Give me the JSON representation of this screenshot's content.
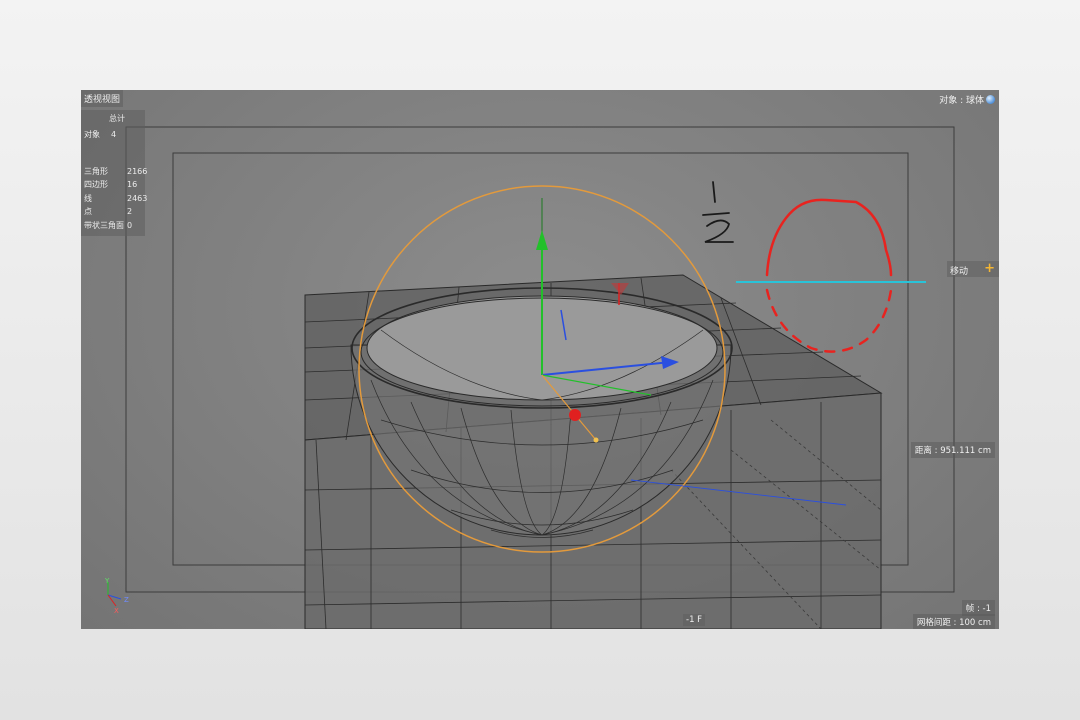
{
  "viewport": {
    "title": "透视视图",
    "object_indicator": {
      "label": "对象 : 球体",
      "icon": "sphere-icon"
    },
    "move_tool": {
      "label": "移动",
      "icon": "plus-icon",
      "accent": "#f4b633"
    },
    "distance": "距离 : 951.111 cm",
    "frame": "帧 : -1",
    "grid_spacing": "网格间距 : 100 cm",
    "frame_counter": "-1 F"
  },
  "stats": {
    "header": "总计",
    "objects": {
      "label": "对象",
      "value": "4"
    },
    "rows": [
      {
        "label": "三角形",
        "value": "2166"
      },
      {
        "label": "四边形",
        "value": "16"
      },
      {
        "label": "线",
        "value": "2463"
      },
      {
        "label": "点",
        "value": "2"
      },
      {
        "label": "带状三角面",
        "value": "0"
      }
    ]
  },
  "annotation": {
    "fraction_numerator": "1",
    "fraction_denominator": "2",
    "sketch_color": "#e8231f",
    "cut_line_color": "#29c3d8"
  },
  "axis_labels": {
    "y": "Y",
    "z": "Z",
    "x": "X"
  },
  "colors": {
    "selection": "#e39a3c",
    "axis_x": "#e02020",
    "axis_y": "#22c02a",
    "axis_z": "#2a4fe0",
    "viewport_bg": "#808080"
  }
}
